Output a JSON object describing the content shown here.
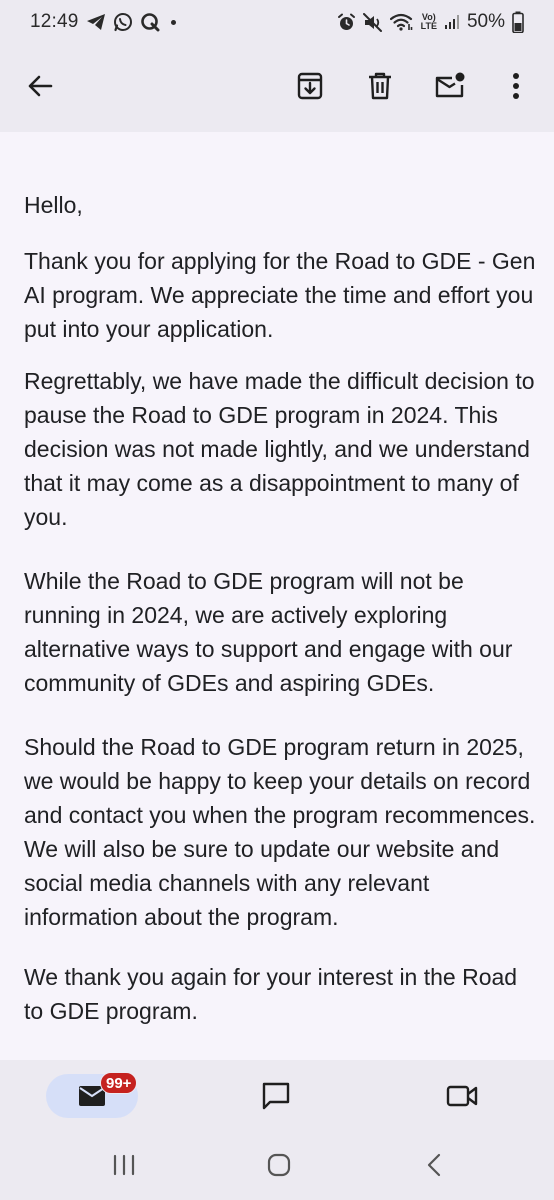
{
  "status_bar": {
    "time": "12:49",
    "battery": "50%",
    "left_icons": [
      "telegram-icon",
      "whatsapp-icon",
      "q-app-icon",
      "notification-dot"
    ],
    "right_icons": [
      "alarm-icon",
      "mute-icon",
      "wifi-icon",
      "volte-icon",
      "signal-icon"
    ],
    "volte_label_top": "Vo)",
    "volte_label_bottom": "LTE"
  },
  "app_bar": {
    "actions": [
      "back-arrow-icon",
      "archive-icon",
      "delete-icon",
      "mark-unread-icon",
      "more-vert-icon"
    ]
  },
  "email": {
    "paragraphs": [
      "Hello,",
      "Thank you for applying for the Road to GDE - Gen AI program. We appreciate the time and effort you put into your application.",
      "Regrettably, we have made the difficult decision to pause the Road to GDE program in 2024. This decision was not made lightly, and we understand that it may come as a disappointment to many of you.",
      "While the Road to GDE program will not be running in 2024, we are actively exploring alternative ways to support and engage with our community of GDEs and aspiring GDEs.",
      "Should the Road to GDE program return in 2025, we would be happy to keep your details on record and contact you when the program recommences. We will also be sure to update our website and social media channels with any relevant information about the program.",
      "We thank you again for your interest in the Road to GDE program."
    ]
  },
  "bottom_nav": {
    "mail_badge": "99+",
    "items": [
      "mail-icon",
      "chat-icon",
      "meet-video-icon"
    ]
  },
  "colors": {
    "bar_bg": "#ECEAF1",
    "content_bg": "#F7F4FB",
    "active_pill": "#D6DFF8",
    "badge_red": "#C5221F",
    "text": "#202124"
  }
}
